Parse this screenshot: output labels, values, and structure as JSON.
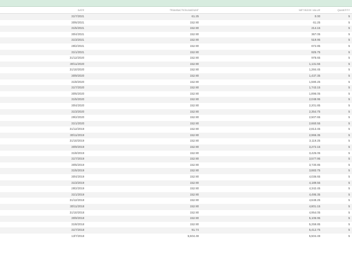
{
  "header": {
    "date": "DATE",
    "transaction_amount": "TRANSACTION AMOUNT",
    "net_book_value": "NET BOOK VALUE",
    "quantity": "QUANTITY"
  },
  "rows": [
    {
      "date": "31/7/2021",
      "amount": "61.25",
      "nbv": "0.00",
      "qty": "5"
    },
    {
      "date": "30/6/2021",
      "amount": "152.90",
      "nbv": "61.25",
      "qty": "5"
    },
    {
      "date": "31/5/2021",
      "amount": "152.90",
      "nbv": "214.15",
      "qty": "5"
    },
    {
      "date": "30/4/2021",
      "amount": "152.90",
      "nbv": "367.05",
      "qty": "5"
    },
    {
      "date": "31/3/2021",
      "amount": "152.90",
      "nbv": "519.95",
      "qty": "5"
    },
    {
      "date": "28/2/2021",
      "amount": "152.90",
      "nbv": "672.85",
      "qty": "5"
    },
    {
      "date": "31/1/2021",
      "amount": "152.90",
      "nbv": "825.75",
      "qty": "5"
    },
    {
      "date": "31/12/2020",
      "amount": "152.90",
      "nbv": "978.65",
      "qty": "5"
    },
    {
      "date": "30/11/2020",
      "amount": "152.90",
      "nbv": "1,131.55",
      "qty": "5"
    },
    {
      "date": "31/10/2020",
      "amount": "152.90",
      "nbv": "1,284.45",
      "qty": "5"
    },
    {
      "date": "30/9/2020",
      "amount": "152.90",
      "nbv": "1,437.35",
      "qty": "5"
    },
    {
      "date": "31/8/2020",
      "amount": "152.90",
      "nbv": "1,590.25",
      "qty": "5"
    },
    {
      "date": "31/7/2020",
      "amount": "152.90",
      "nbv": "1,743.15",
      "qty": "5"
    },
    {
      "date": "30/6/2020",
      "amount": "152.90",
      "nbv": "1,896.05",
      "qty": "5"
    },
    {
      "date": "31/5/2020",
      "amount": "152.90",
      "nbv": "2,048.95",
      "qty": "5"
    },
    {
      "date": "30/4/2020",
      "amount": "152.90",
      "nbv": "2,201.85",
      "qty": "5"
    },
    {
      "date": "31/3/2020",
      "amount": "152.90",
      "nbv": "2,354.75",
      "qty": "5"
    },
    {
      "date": "29/2/2020",
      "amount": "152.90",
      "nbv": "2,507.65",
      "qty": "5"
    },
    {
      "date": "31/1/2020",
      "amount": "152.90",
      "nbv": "2,660.55",
      "qty": "5"
    },
    {
      "date": "31/12/2019",
      "amount": "152.90",
      "nbv": "2,813.45",
      "qty": "5"
    },
    {
      "date": "30/11/2019",
      "amount": "152.90",
      "nbv": "2,966.35",
      "qty": "5"
    },
    {
      "date": "31/10/2019",
      "amount": "152.90",
      "nbv": "3,119.25",
      "qty": "5"
    },
    {
      "date": "30/9/2019",
      "amount": "152.90",
      "nbv": "3,272.15",
      "qty": "5"
    },
    {
      "date": "31/8/2019",
      "amount": "152.90",
      "nbv": "3,425.05",
      "qty": "5"
    },
    {
      "date": "31/7/2019",
      "amount": "152.90",
      "nbv": "3,577.95",
      "qty": "5"
    },
    {
      "date": "30/6/2019",
      "amount": "152.90",
      "nbv": "3,730.85",
      "qty": "5"
    },
    {
      "date": "31/5/2019",
      "amount": "152.90",
      "nbv": "3,883.75",
      "qty": "5"
    },
    {
      "date": "30/4/2019",
      "amount": "152.90",
      "nbv": "4,036.65",
      "qty": "5"
    },
    {
      "date": "31/3/2019",
      "amount": "152.90",
      "nbv": "4,189.55",
      "qty": "5"
    },
    {
      "date": "28/2/2019",
      "amount": "152.90",
      "nbv": "4,342.45",
      "qty": "5"
    },
    {
      "date": "31/1/2019",
      "amount": "152.90",
      "nbv": "4,495.35",
      "qty": "5"
    },
    {
      "date": "31/12/2018",
      "amount": "152.90",
      "nbv": "4,648.25",
      "qty": "5"
    },
    {
      "date": "30/11/2018",
      "amount": "152.90",
      "nbv": "4,801.15",
      "qty": "5"
    },
    {
      "date": "31/10/2018",
      "amount": "152.90",
      "nbv": "4,954.05",
      "qty": "5"
    },
    {
      "date": "30/9/2018",
      "amount": "152.90",
      "nbv": "5,106.95",
      "qty": "5"
    },
    {
      "date": "31/8/2018",
      "amount": "152.90",
      "nbv": "5,259.85",
      "qty": "5"
    },
    {
      "date": "31/7/2018",
      "amount": "91.74",
      "nbv": "5,412.75",
      "qty": "5"
    },
    {
      "date": "13/7/2018",
      "amount": "5,504.49",
      "nbv": "5,504.49",
      "qty": "5"
    }
  ]
}
